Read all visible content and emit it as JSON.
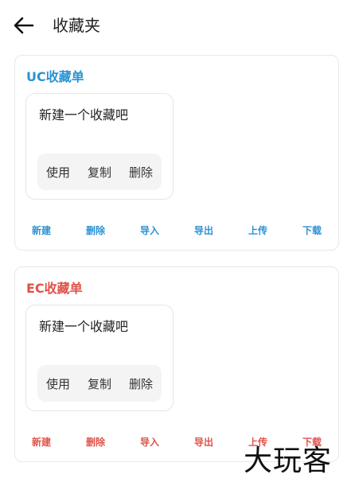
{
  "header": {
    "title": "收藏夹",
    "back_icon": "arrow-left-icon"
  },
  "colors": {
    "uc_accent": "#2a93d5",
    "ec_accent": "#e0524a"
  },
  "uc": {
    "title": "UC收藏单",
    "item": {
      "name": "新建一个收藏吧",
      "actions": [
        "使用",
        "复制",
        "删除"
      ]
    },
    "toolbar": [
      "新建",
      "删除",
      "导入",
      "导出",
      "上传",
      "下载"
    ]
  },
  "ec": {
    "title": "EC收藏单",
    "item": {
      "name": "新建一个收藏吧",
      "actions": [
        "使用",
        "复制",
        "删除"
      ]
    },
    "toolbar": [
      "新建",
      "删除",
      "导入",
      "导出",
      "上传",
      "下载"
    ]
  },
  "watermark": "大玩客"
}
